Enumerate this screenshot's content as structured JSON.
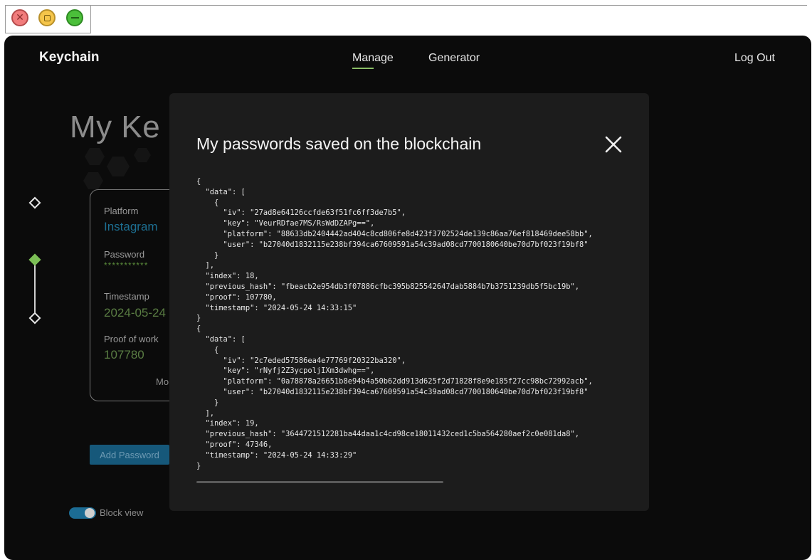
{
  "nav": {
    "brand": "Keychain",
    "manage": "Manage",
    "generator": "Generator",
    "logout": "Log Out"
  },
  "page": {
    "title": "My Ke"
  },
  "card": {
    "platform_label": "Platform",
    "platform_value": "Instagram",
    "password_label": "Password",
    "password_value": "***********",
    "timestamp_label": "Timestamp",
    "timestamp_value": "2024-05-24",
    "pow_label": "Proof of work",
    "pow_value": "107780",
    "more_label": "Mo"
  },
  "actions": {
    "add_password": "Add Password",
    "block_view": "Block view"
  },
  "modal": {
    "title": "My passwords saved on the blockchain",
    "blocks": [
      "{\n  \"data\": [\n    {\n      \"iv\": \"27ad8e64126ccfde63f51fc6ff3de7b5\",\n      \"key\": \"VeurRDfae7MS/RsWdDZAPg==\",\n      \"platform\": \"88633db2404442ad404c8cd806fe8d423f3702524de139c86aa76ef818469dee58bb\",\n      \"user\": \"b27040d1832115e238bf394ca67609591a54c39ad08cd7700180640be70d7bf023f19bf8\"\n    }\n  ],\n  \"index\": 18,\n  \"previous_hash\": \"fbeacb2e954db3f07886cfbc395b825542647dab5884b7b3751239db5f5bc19b\",\n  \"proof\": 107780,\n  \"timestamp\": \"2024-05-24 14:33:15\"\n}",
      "{\n  \"data\": [\n    {\n      \"iv\": \"2c7eded57586ea4e77769f20322ba320\",\n      \"key\": \"rNyfj2Z3ycpoljIXm3dwhg==\",\n      \"platform\": \"0a78878a26651b8e94b4a50b62dd913d625f2d71828f8e9e185f27cc98bc72992acb\",\n      \"user\": \"b27040d1832115e238bf394ca67609591a54c39ad08cd7700180640be70d7bf023f19bf8\"\n    }\n  ],\n  \"index\": 19,\n  \"previous_hash\": \"3644721512281ba44daa1c4cd98ce18011432ced1c5ba564280aef2c0e081da8\",\n  \"proof\": 47346,\n  \"timestamp\": \"2024-05-24 14:33:29\"\n}"
    ]
  }
}
